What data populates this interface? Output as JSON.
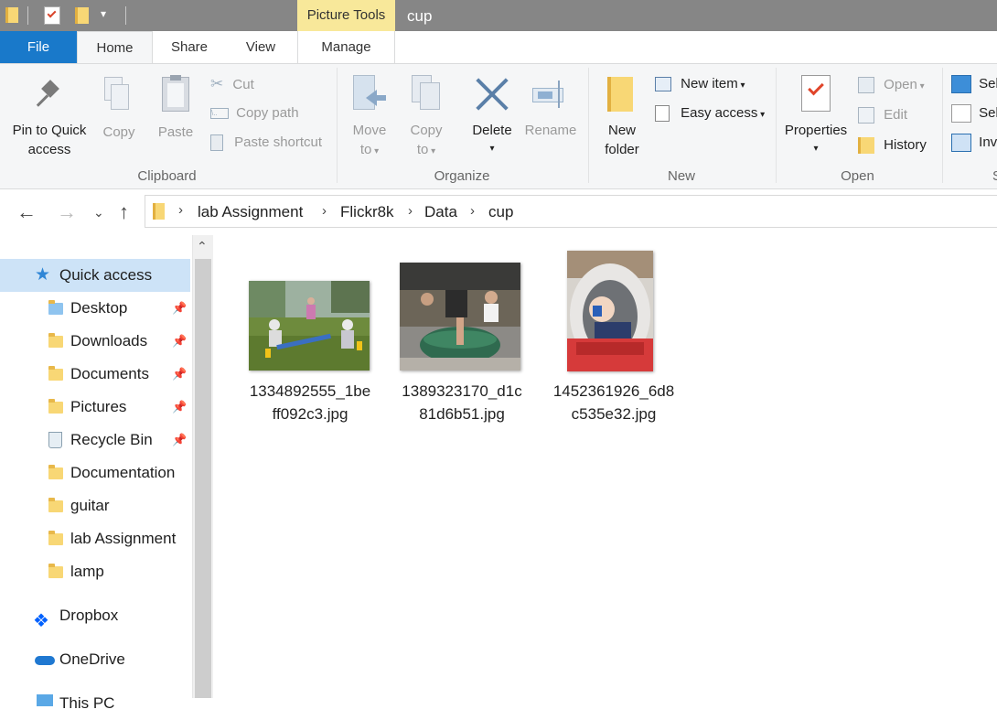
{
  "window": {
    "title": "cup",
    "context_tab": "Picture Tools"
  },
  "tabs": {
    "file": "File",
    "home": "Home",
    "share": "Share",
    "view": "View",
    "manage": "Manage"
  },
  "ribbon": {
    "clipboard": {
      "label": "Clipboard",
      "pin_line1": "Pin to Quick",
      "pin_line2": "access",
      "copy": "Copy",
      "paste": "Paste",
      "cut": "Cut",
      "copy_path": "Copy path",
      "paste_shortcut": "Paste shortcut"
    },
    "organize": {
      "label": "Organize",
      "move_line1": "Move",
      "move_line2": "to",
      "copy_line1": "Copy",
      "copy_line2": "to",
      "delete": "Delete",
      "rename": "Rename"
    },
    "new": {
      "label": "New",
      "folder_line1": "New",
      "folder_line2": "folder",
      "new_item": "New item",
      "easy_access": "Easy access"
    },
    "open": {
      "label": "Open",
      "properties": "Properties",
      "open": "Open",
      "edit": "Edit",
      "history": "History"
    },
    "select": {
      "item1": "Sele",
      "item2": "Sele",
      "item3": "Inve",
      "label_partial": "S"
    }
  },
  "address": {
    "crumbs": [
      "lab Assignment",
      "Flickr8k",
      "Data",
      "cup"
    ]
  },
  "nav": {
    "quick_access": "Quick access",
    "items": [
      "Desktop",
      "Downloads",
      "Documents",
      "Pictures",
      "Recycle Bin",
      "Documentation",
      "guitar",
      "lab Assignment",
      "lamp"
    ],
    "dropbox": "Dropbox",
    "onedrive": "OneDrive",
    "thispc_partial": "This PC"
  },
  "files": [
    {
      "line1": "1334892555_1be",
      "line2": "ff092c3.jpg"
    },
    {
      "line1": "1389323170_d1c",
      "line2": "81d6b51.jpg"
    },
    {
      "line1": "1452361926_6d8",
      "line2": "c535e32.jpg"
    }
  ],
  "colors": {
    "accent": "#1979ca",
    "context_tab": "#f8e89a",
    "selected": "#cde3f7",
    "titlebar": "#868686"
  }
}
